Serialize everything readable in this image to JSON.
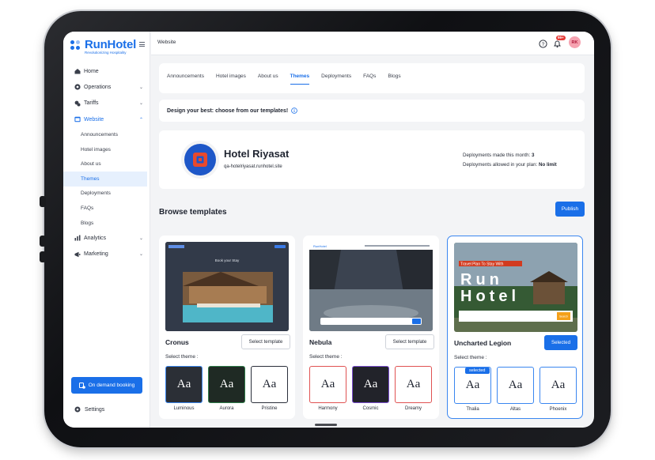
{
  "brand": {
    "name": "RunHotel",
    "tagline": "Revolutionizing Hospitality"
  },
  "header": {
    "breadcrumb": "Website",
    "notification_badge": "99+",
    "avatar_initials": "RK"
  },
  "sidebar": {
    "items": [
      {
        "label": "Home",
        "icon": "home-icon"
      },
      {
        "label": "Operations",
        "icon": "operations-icon",
        "expandable": true
      },
      {
        "label": "Tariffs",
        "icon": "tariffs-icon",
        "expandable": true
      },
      {
        "label": "Website",
        "icon": "website-icon",
        "expandable": true,
        "expanded": true,
        "active": true
      },
      {
        "label": "Analytics",
        "icon": "analytics-icon",
        "expandable": true
      },
      {
        "label": "Marketing",
        "icon": "marketing-icon",
        "expandable": true
      }
    ],
    "website_subitems": [
      "Announcements",
      "Hotel images",
      "About us",
      "Themes",
      "Deployments",
      "FAQs",
      "Blogs"
    ],
    "active_subitem": "Themes",
    "on_demand_label": "On demand booking",
    "settings_label": "Settings"
  },
  "tabs": [
    "Announcements",
    "Hotel images",
    "About us",
    "Themes",
    "Deployments",
    "FAQs",
    "Blogs"
  ],
  "active_tab": "Themes",
  "design_prompt": "Design your best: choose from our templates!",
  "hotel": {
    "name": "Hotel Riyasat",
    "url": "qa-hotelriyasat.runhotel.site",
    "deployments_month_label": "Deployments made this month:",
    "deployments_month_value": "3",
    "deployments_allowed_label": "Deployments allowed in your plan:",
    "deployments_allowed_value": "No limit"
  },
  "browse": {
    "title": "Browse templates",
    "publish_label": "Publish"
  },
  "templates": [
    {
      "name": "Cronus",
      "button_label": "Select template",
      "selected": false,
      "theme_label": "Select theme :",
      "preview_texts": {
        "logo": "RUNHOTEL",
        "headline": "Book your Stay"
      },
      "themes": [
        {
          "name": "Luminous",
          "sample": "Aa",
          "bg": "#2b2f36",
          "fg": "#ffffff",
          "border": "#3a86f0"
        },
        {
          "name": "Aurora",
          "sample": "Aa",
          "bg": "#1f2a24",
          "fg": "#ffffff",
          "border": "#2f7d4a"
        },
        {
          "name": "Pristine",
          "sample": "Aa",
          "bg": "#ffffff",
          "fg": "#1f2430",
          "border": "#2a2f3a"
        }
      ]
    },
    {
      "name": "Nebula",
      "button_label": "Select template",
      "selected": false,
      "theme_label": "Select theme :",
      "preview_texts": {
        "logo": "RunHotel"
      },
      "themes": [
        {
          "name": "Harmony",
          "sample": "Aa",
          "bg": "#ffffff",
          "fg": "#1f2430",
          "border": "#e05252"
        },
        {
          "name": "Cosmic",
          "sample": "Aa",
          "bg": "#22232a",
          "fg": "#ffffff",
          "border": "#7b4fd0"
        },
        {
          "name": "Dreamy",
          "sample": "Aa",
          "bg": "#ffffff",
          "fg": "#1f2430",
          "border": "#e05252"
        }
      ]
    },
    {
      "name": "Uncharted Legion",
      "button_label": "Selected",
      "selected": true,
      "theme_label": "Select theme :",
      "preview_texts": {
        "banner": "Travel Plan To Stay With",
        "big_1": "Run",
        "big_2": "Hotel",
        "cta": "Search"
      },
      "selected_theme_badge": "selected",
      "themes": [
        {
          "name": "Thalia",
          "sample": "Aa",
          "bg": "#ffffff",
          "fg": "#1f2430",
          "border": "#3a86f0"
        },
        {
          "name": "Altas",
          "sample": "Aa",
          "bg": "#ffffff",
          "fg": "#1f2430",
          "border": "#3a86f0"
        },
        {
          "name": "Phoenix",
          "sample": "Aa",
          "bg": "#ffffff",
          "fg": "#1f2430",
          "border": "#3a86f0"
        }
      ]
    }
  ],
  "colors": {
    "accent": "#1a6fe8",
    "active_bg": "#e6f0fd",
    "badge_red": "#e53935"
  }
}
